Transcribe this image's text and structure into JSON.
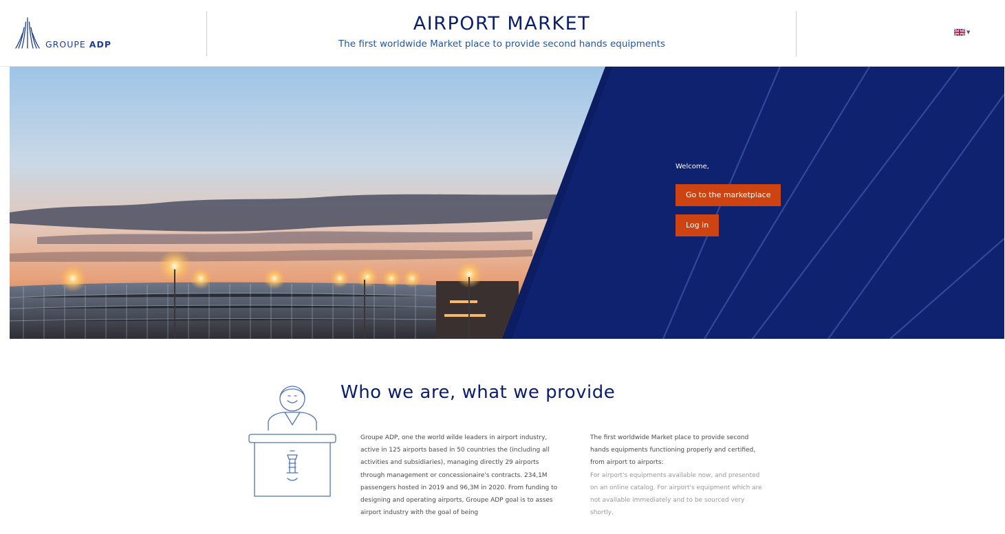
{
  "header": {
    "logo_prefix": "GROUPE ",
    "logo_bold": "ADP",
    "title": "AIRPORT MARKET",
    "subtitle": "The first worldwide Market place to provide second hands equipments",
    "language": "UK flag"
  },
  "hero": {
    "welcome": "Welcome,",
    "marketplace_button": "Go to the marketplace",
    "login_button": "Log in"
  },
  "about": {
    "title": "Who we are, what we provide",
    "col1": "Groupe ADP, one the world wilde leaders in airport industry, active in 125 airports based in 50 countries the (including all activities and subsidiaries), managing directly 29 airports through management or concessionaire's contracts. 234,1M passengers hosted in 2019 and 96,3M in 2020. From funding to designing and operating airports, Groupe ADP goal is to asses airport industry with the goal of being",
    "col2_intro": "The first worldwide Market place to provide second hands equipments functioning properly and certified, from airport to airports:",
    "col2_body": "For airport's equipments available now, and presented on an online catalog. For airport's equipment which are not available immediately and to be sourced very shortly,"
  },
  "colors": {
    "navy": "#0f2270",
    "orange": "#cd4412",
    "title_blue": "#0a1e6e",
    "subtitle_blue": "#1f57a6"
  },
  "icons": [
    "groupe-adp-logo-icon",
    "uk-flag-icon",
    "chevron-down-icon",
    "receptionist-desk-illustration"
  ]
}
